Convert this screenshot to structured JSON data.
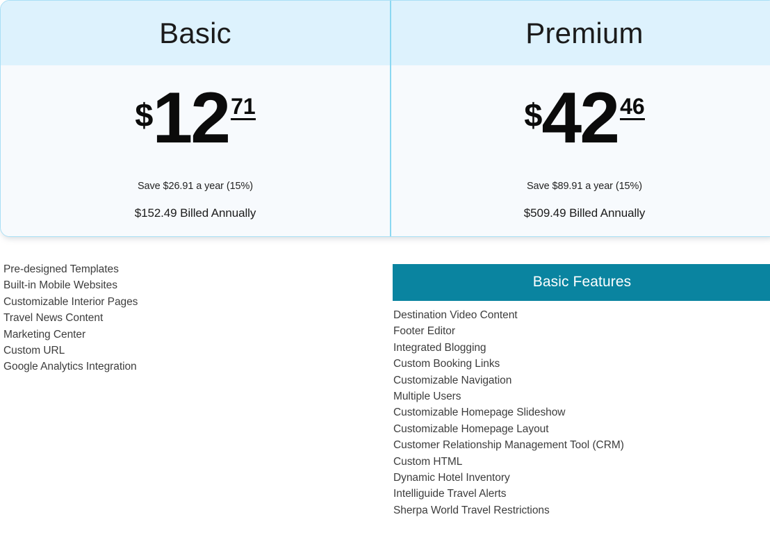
{
  "theme": {
    "header_blue": "#ddf2fd",
    "card_body": "#f7fafd",
    "card_border": "#a8dff5",
    "divider": "#8bd8f2",
    "teal_accent": "#0a84a0",
    "text_dark": "#1b1b1b",
    "text_body": "#3d3d3d"
  },
  "plans": [
    {
      "name": "Basic",
      "currency_symbol": "$",
      "price_whole": "12",
      "price_cents": "71",
      "savings": "Save $26.91 a year (15%)",
      "billed": "$152.49 Billed Annually"
    },
    {
      "name": "Premium",
      "currency_symbol": "$",
      "price_whole": "42",
      "price_cents": "46",
      "savings": "Save $89.91 a year (15%)",
      "billed": "$509.49 Billed Annually"
    }
  ],
  "left_features": {
    "items": [
      "Pre-designed Templates",
      "Built-in Mobile Websites",
      "Customizable Interior Pages",
      "Travel News Content",
      "Marketing Center",
      "Custom URL",
      "Google Analytics Integration"
    ]
  },
  "right_features": {
    "heading": "Basic Features",
    "items": [
      "Destination Video Content",
      "Footer Editor",
      "Integrated Blogging",
      "Custom Booking Links",
      "Customizable Navigation",
      "Multiple Users",
      "Customizable Homepage Slideshow",
      "Customizable Homepage Layout",
      "Customer Relationship Management Tool (CRM)",
      "Custom HTML",
      "Dynamic Hotel Inventory",
      "Intelliguide Travel Alerts",
      "Sherpa World Travel Restrictions"
    ]
  }
}
